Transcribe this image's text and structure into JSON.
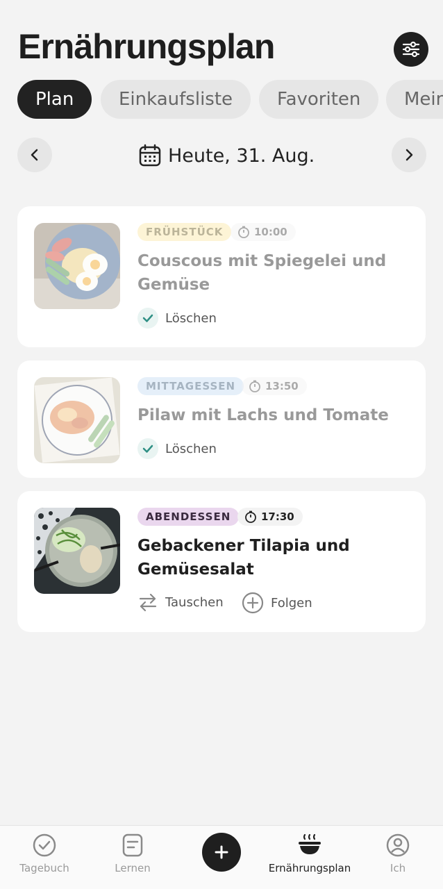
{
  "header": {
    "title": "Ernährungsplan",
    "filter_icon": "sliders-icon"
  },
  "tabs": [
    {
      "label": "Plan",
      "active": true
    },
    {
      "label": "Einkaufsliste",
      "active": false
    },
    {
      "label": "Favoriten",
      "active": false
    },
    {
      "label": "Mein",
      "active": false
    }
  ],
  "date_nav": {
    "label": "Heute, 31. Aug.",
    "prev_icon": "chevron-left-icon",
    "next_icon": "chevron-right-icon",
    "calendar_icon": "calendar-icon"
  },
  "meals": [
    {
      "tag": "FRÜHSTÜCK",
      "tag_bg": "#fdf0c4",
      "tag_color": "#8a7a3e",
      "time": "10:00",
      "title": "Couscous mit Spiegelei und Gemüse",
      "completed": true,
      "actions": [
        {
          "icon": "check-icon",
          "label": "Löschen"
        }
      ]
    },
    {
      "tag": "MITTAGESSEN",
      "tag_bg": "#dde9f6",
      "tag_color": "#5b7590",
      "time": "13:50",
      "title": "Pilaw mit Lachs und Tomate",
      "completed": true,
      "actions": [
        {
          "icon": "check-icon",
          "label": "Löschen"
        }
      ]
    },
    {
      "tag": "ABENDESSEN",
      "tag_bg": "#ead7ee",
      "tag_color": "#3a2a3f",
      "time": "17:30",
      "title": "Gebackener Tilapia und Gemüsesalat",
      "completed": false,
      "actions": [
        {
          "icon": "swap-icon",
          "label": "Tauschen"
        },
        {
          "icon": "plus-circle-icon",
          "label": "Folgen"
        }
      ]
    }
  ],
  "bottom_nav": {
    "items": [
      {
        "icon": "check-circle-icon",
        "label": "Tagebuch",
        "active": false
      },
      {
        "icon": "document-icon",
        "label": "Lernen",
        "active": false
      },
      {
        "icon": "plus-icon",
        "label": "",
        "active": false
      },
      {
        "icon": "bowl-icon",
        "label": "Ernährungsplan",
        "active": true
      },
      {
        "icon": "user-icon",
        "label": "Ich",
        "active": false
      }
    ]
  },
  "colors": {
    "accent_dark": "#1f1f1f",
    "check_teal": "#2e8f84",
    "background": "#f3f3f3"
  }
}
